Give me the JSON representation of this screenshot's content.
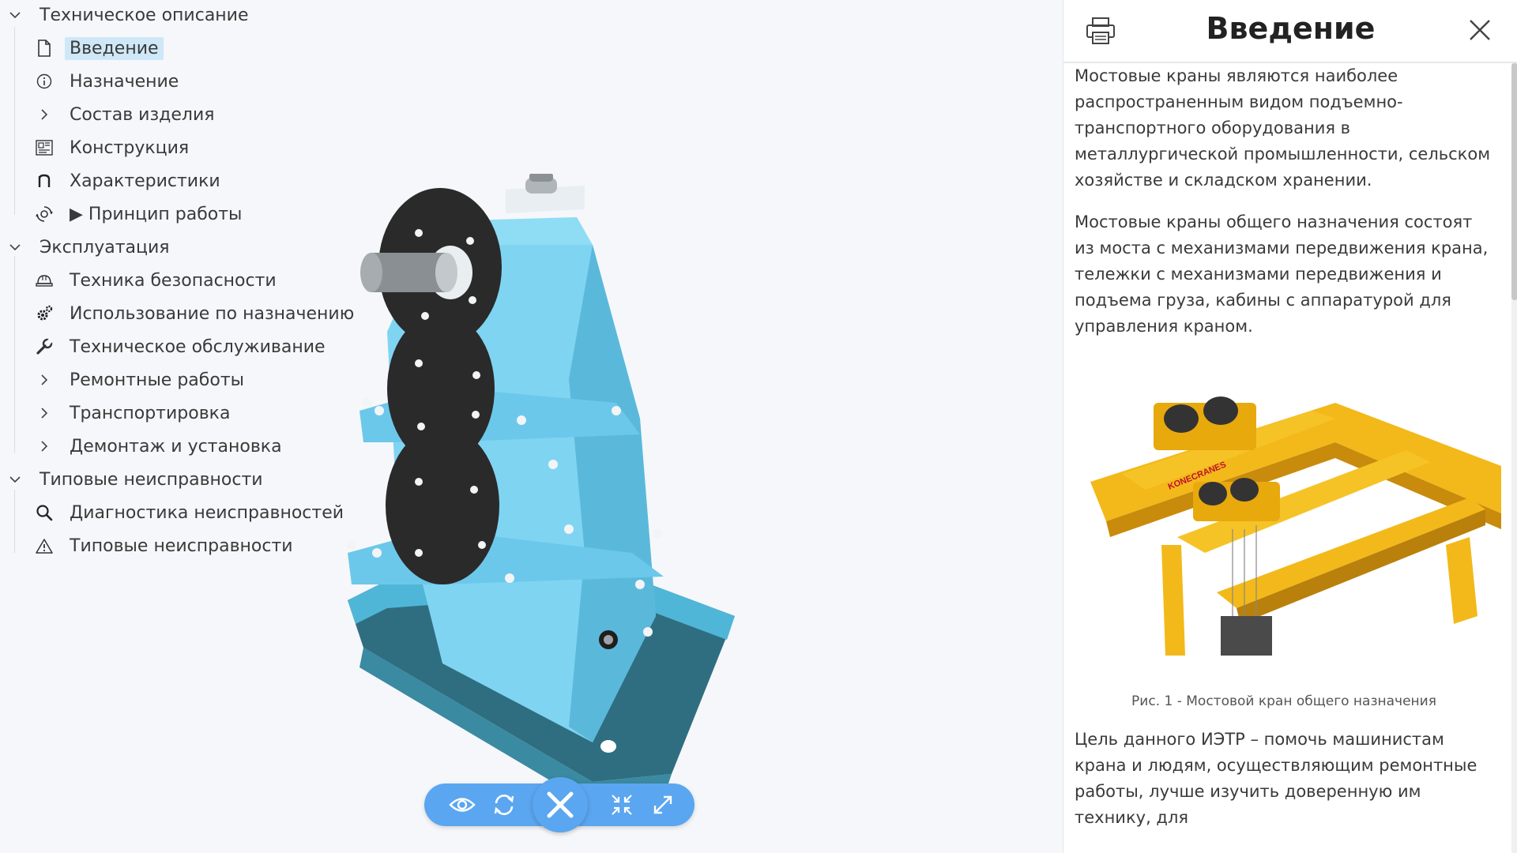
{
  "tree": {
    "sections": [
      {
        "label": "Техническое описание",
        "items": [
          {
            "label": "Введение",
            "icon": "document-icon",
            "active": true
          },
          {
            "label": "Назначение",
            "icon": "info-icon"
          },
          {
            "label": "Состав изделия",
            "icon": "chevron-right-icon"
          },
          {
            "label": "Конструкция",
            "icon": "blueprint-icon"
          },
          {
            "label": "Характеристики",
            "icon": "n-letter-icon"
          },
          {
            "label": "▶ Принцип работы",
            "icon": "mechanism-icon"
          }
        ]
      },
      {
        "label": "Эксплуатация",
        "items": [
          {
            "label": "Техника безопасности",
            "icon": "hardhat-icon"
          },
          {
            "label": "Использование по назначению",
            "icon": "gears-icon"
          },
          {
            "label": "Техническое обслуживание",
            "icon": "wrench-icon"
          },
          {
            "label": "Ремонтные работы",
            "icon": "chevron-right-icon"
          },
          {
            "label": "Транспортировка",
            "icon": "chevron-right-icon"
          },
          {
            "label": "Демонтаж и установка",
            "icon": "chevron-right-icon"
          }
        ]
      },
      {
        "label": "Типовые неисправности",
        "items": [
          {
            "label": "Диагностика неисправностей",
            "icon": "search-icon"
          },
          {
            "label": "Типовые неисправности",
            "icon": "warning-icon"
          }
        ]
      }
    ]
  },
  "viewer": {
    "toolbar": [
      "eye-icon",
      "refresh-icon",
      "close-icon",
      "collapse-icon",
      "expand-icon"
    ],
    "model_color": "#7fd4f2"
  },
  "panel": {
    "title": "Введение",
    "paragraphs": [
      "Мостовые краны являются наиболее распространенным видом подъемно-транспортного оборудования в металлургической промышленности, сельском хозяйстве и складском хранении.",
      "Мостовые краны общего назначения состоят из моста с механизмами передвижения крана, тележки с механизмами передвижения и подъема груза, кабины с аппаратурой для управления краном."
    ],
    "figure_caption": "Рис. 1 - Мостовой кран общего назначения",
    "figure_label": "KONECRANES",
    "last_paragraph": "Цель данного ИЭТР – помочь машинистам крана и людям, осуществляющим ремонтные работы, лучше изучить доверенную им технику, для"
  },
  "colors": {
    "accent": "#5aa6f0",
    "active_bg": "#cfe8f8",
    "crane": "#f5c518"
  }
}
